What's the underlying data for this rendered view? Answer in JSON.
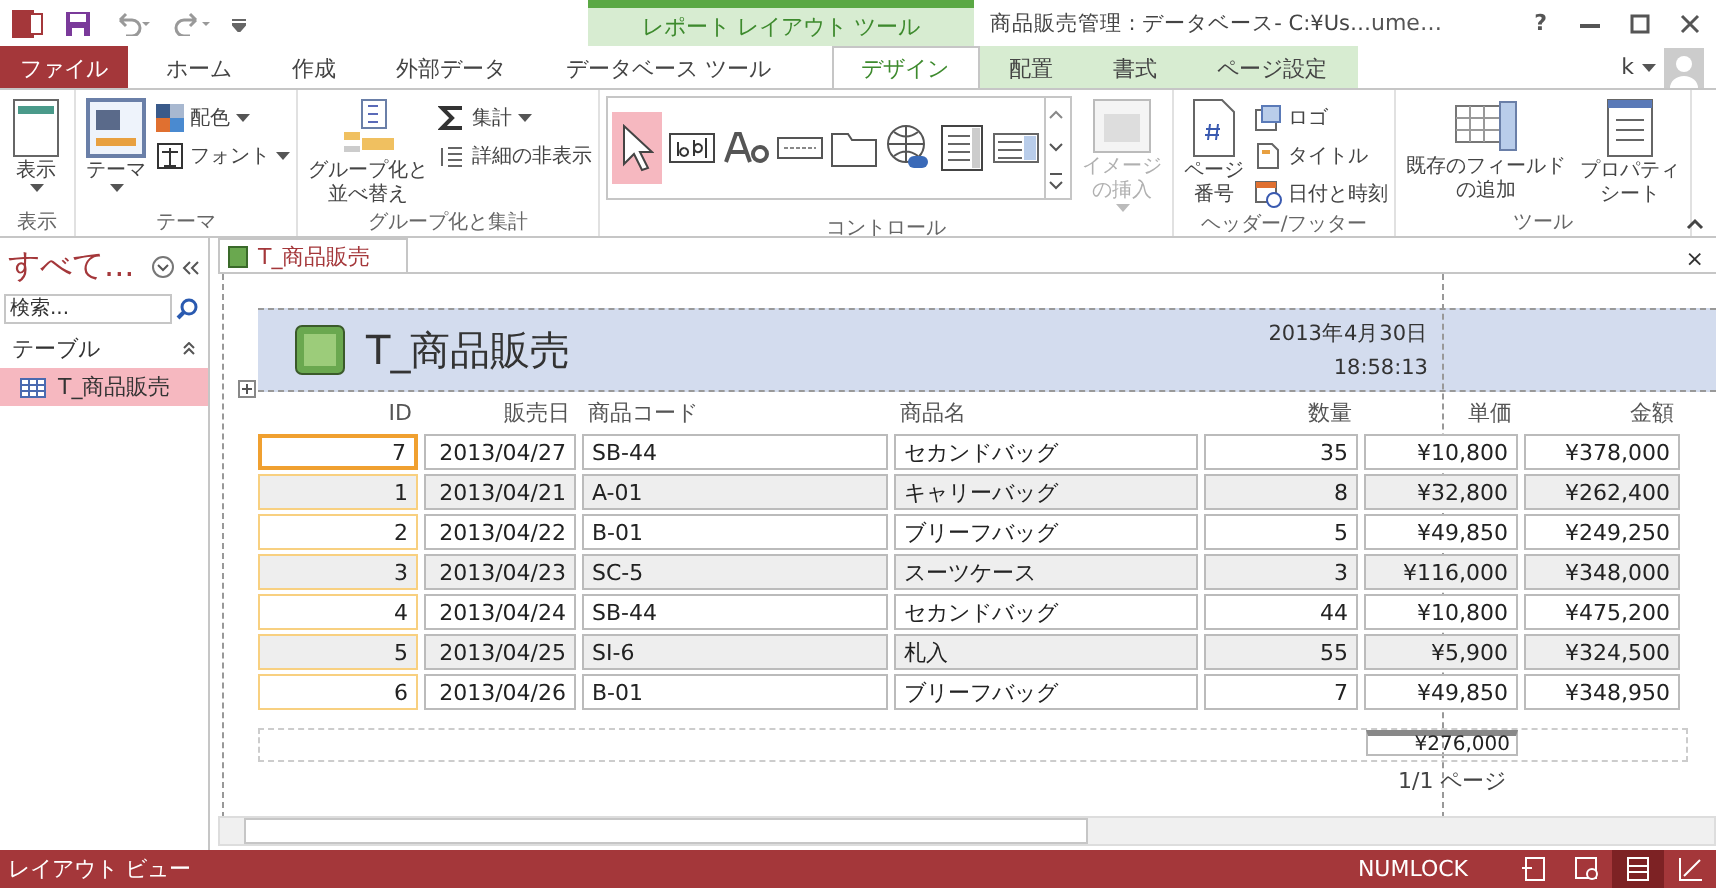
{
  "title_bar": {
    "context_group": "レポート レイアウト ツール",
    "title": "商品販売管理 : データベース- C:¥Us…",
    "user": "ume…",
    "help": "?"
  },
  "tabs": [
    {
      "label": "ファイル",
      "kind": "file",
      "selected": false
    },
    {
      "label": "ホーム",
      "kind": "normal",
      "selected": false
    },
    {
      "label": "作成",
      "kind": "normal",
      "selected": false
    },
    {
      "label": "外部データ",
      "kind": "normal",
      "selected": false
    },
    {
      "label": "データベース ツール",
      "kind": "normal",
      "selected": false
    },
    {
      "label": "デザイン",
      "kind": "context",
      "selected": true
    },
    {
      "label": "配置",
      "kind": "context",
      "selected": false
    },
    {
      "label": "書式",
      "kind": "context",
      "selected": false
    },
    {
      "label": "ページ設定",
      "kind": "context",
      "selected": false
    }
  ],
  "account": {
    "user": "k"
  },
  "ribbon": {
    "groups": [
      {
        "label": "表示",
        "commands": [
          {
            "lines": [
              "表示"
            ],
            "kind": "large",
            "dropdown": true
          }
        ]
      },
      {
        "label": "テーマ",
        "commands": [
          {
            "lines": [
              "テーマ"
            ],
            "kind": "large",
            "dropdown": true
          },
          {
            "label": "配色",
            "kind": "small",
            "dropdown": true
          },
          {
            "label": "フォント",
            "kind": "small",
            "dropdown": true
          }
        ]
      },
      {
        "label": "グループ化と集計",
        "commands": [
          {
            "lines": [
              "グループ化と",
              "並べ替え"
            ],
            "kind": "large",
            "dropdown": false
          },
          {
            "label": "集計",
            "kind": "small",
            "dropdown": true
          },
          {
            "label": "詳細の非表示",
            "kind": "small",
            "dropdown": false
          }
        ]
      },
      {
        "label": "コントロール",
        "commands": [
          {
            "kind": "gallery",
            "items": [
              {
                "selected": true
              },
              {
                "selected": false
              },
              {
                "selected": false
              },
              {
                "selected": false
              },
              {
                "selected": false
              },
              {
                "selected": false
              },
              {
                "selected": false
              },
              {
                "selected": false
              }
            ]
          },
          {
            "lines": [
              "イメージ",
              "の挿入"
            ],
            "kind": "large",
            "dropdown": true,
            "disabled": true
          }
        ]
      },
      {
        "label": "ヘッダー/フッター",
        "commands": [
          {
            "lines": [
              "ページ",
              "番号"
            ],
            "kind": "large",
            "dropdown": false
          },
          {
            "label": "ロゴ",
            "kind": "small",
            "dropdown": false
          },
          {
            "label": "タイトル",
            "kind": "small",
            "dropdown": false
          },
          {
            "label": "日付と時刻",
            "kind": "small",
            "dropdown": false
          }
        ]
      },
      {
        "label": "ツール",
        "commands": [
          {
            "lines": [
              "既存のフィールド",
              "の追加"
            ],
            "kind": "large",
            "dropdown": false
          },
          {
            "lines": [
              "プロパティ",
              "シート"
            ],
            "kind": "large",
            "dropdown": false
          }
        ]
      }
    ]
  },
  "nav_pane": {
    "title": "すべて...",
    "search": {
      "placeholder": "検索..."
    },
    "group": "テーブル",
    "items": [
      {
        "label": "T_商品販売",
        "selected": true
      }
    ]
  },
  "document_tab": {
    "label": "T_商品販売",
    "close": "×"
  },
  "report": {
    "title": "T_商品販売",
    "date": "2013年4月30日",
    "time": "18:58:13",
    "columns": [
      "ID",
      "販売日",
      "商品コード",
      "商品名",
      "数量",
      "単価",
      "金額"
    ],
    "rows": [
      {
        "cells": [
          "7",
          "2013/04/27",
          "SB-44",
          "セカンドバッグ",
          "35",
          "¥10,800",
          "¥378,000"
        ],
        "selected": true
      },
      {
        "cells": [
          "1",
          "2013/04/21",
          "A-01",
          "キャリーバッグ",
          "8",
          "¥32,800",
          "¥262,400"
        ],
        "selected": false
      },
      {
        "cells": [
          "2",
          "2013/04/22",
          "B-01",
          "ブリーフバッグ",
          "5",
          "¥49,850",
          "¥249,250"
        ],
        "selected": false
      },
      {
        "cells": [
          "3",
          "2013/04/23",
          "SC-5",
          "スーツケース",
          "3",
          "¥116,000",
          "¥348,000"
        ],
        "selected": false
      },
      {
        "cells": [
          "4",
          "2013/04/24",
          "SB-44",
          "セカンドバッグ",
          "44",
          "¥10,800",
          "¥475,200"
        ],
        "selected": false
      },
      {
        "cells": [
          "5",
          "2013/04/25",
          "SI-6",
          "札入",
          "55",
          "¥5,900",
          "¥324,500"
        ],
        "selected": false
      },
      {
        "cells": [
          "6",
          "2013/04/26",
          "B-01",
          "ブリーフバッグ",
          "7",
          "¥49,850",
          "¥348,950"
        ],
        "selected": false
      }
    ],
    "total": "¥276,000",
    "page": "1/1 ページ"
  },
  "status_bar": {
    "view": "レイアウト ビュー",
    "numlock": "NUMLOCK",
    "views": [
      {
        "selected": false
      },
      {
        "selected": false
      },
      {
        "selected": true
      },
      {
        "selected": false
      }
    ]
  }
}
